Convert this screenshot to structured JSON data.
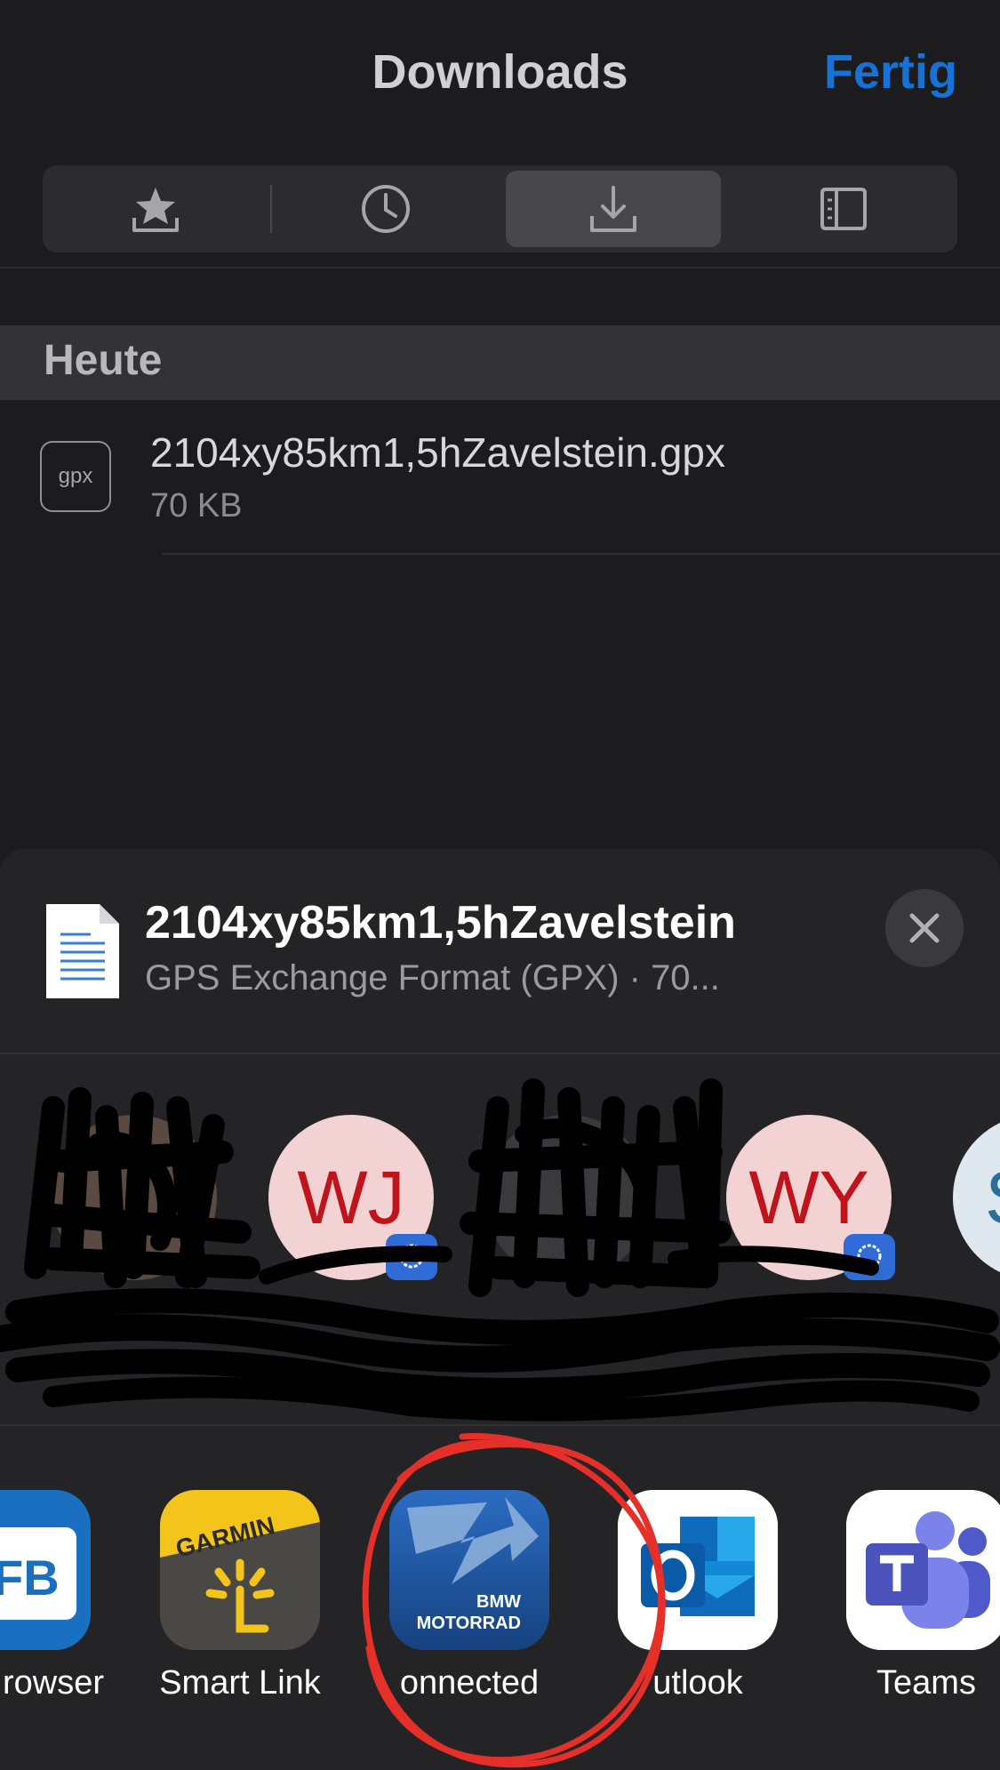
{
  "header": {
    "title": "Downloads",
    "done_label": "Fertig"
  },
  "tabs": [
    {
      "name": "bookmarks",
      "icon": "star-tray-icon",
      "active": false
    },
    {
      "name": "history",
      "icon": "clock-icon",
      "active": false
    },
    {
      "name": "downloads",
      "icon": "download-tray-icon",
      "active": true
    },
    {
      "name": "reading-list",
      "icon": "book-icon",
      "active": false
    }
  ],
  "section": {
    "label": "Heute"
  },
  "download": {
    "icon_text": "gpx",
    "filename": "2104xy85km1,5hZavelstein.gpx",
    "size": "70 KB"
  },
  "share_sheet": {
    "title": "2104xy85km1,5hZavelstein",
    "subtitle": "GPS Exchange Format (GPX) · 70...",
    "contacts": [
      {
        "initials": "WJ",
        "badge": "signal-icon"
      },
      {
        "initials": "WY",
        "badge": "signal-icon"
      },
      {
        "initials": "S",
        "badge": ""
      }
    ],
    "apps": [
      {
        "label": "rowser",
        "icon": "fb-browser-icon"
      },
      {
        "label": "Smart Link",
        "icon": "garmin-smart-link-icon",
        "icon_text": "GARMIN"
      },
      {
        "label": "onnected",
        "icon": "bmw-motorrad-connected-icon",
        "icon_text_1": "BMW",
        "icon_text_2": "MOTORRAD"
      },
      {
        "label": "utlook",
        "icon": "outlook-icon"
      },
      {
        "label": "Teams",
        "icon": "teams-icon"
      }
    ]
  },
  "colors": {
    "accent": "#1672d6",
    "annotation": "#e5302a"
  }
}
